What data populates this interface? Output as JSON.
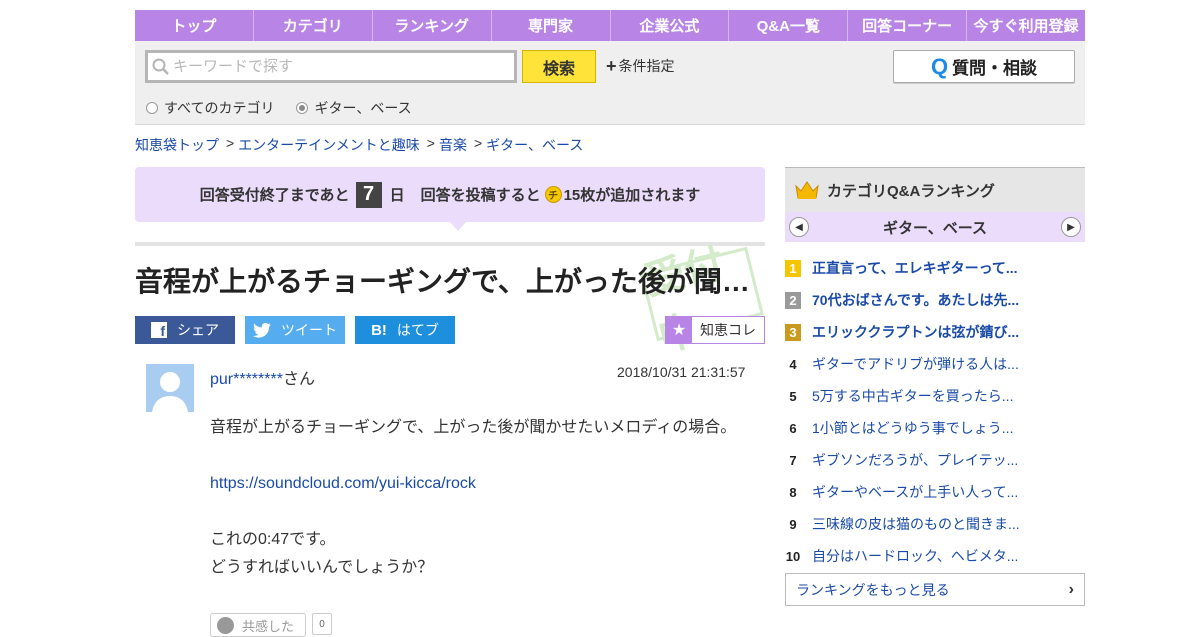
{
  "nav": [
    "トップ",
    "カテゴリ",
    "ランキング",
    "専門家",
    "企業公式",
    "Q&A一覧",
    "回答コーナー",
    "今すぐ利用登録"
  ],
  "search": {
    "placeholder": "キーワードで探す",
    "button": "検索",
    "conditions": "条件指定",
    "ask_button": "質問・相談",
    "scope_all": "すべてのカテゴリ",
    "scope_current": "ギター、ベース"
  },
  "breadcrumb": [
    "知恵袋トップ",
    "エンターテインメントと趣味",
    "音楽",
    "ギター、ベース"
  ],
  "deadline": {
    "prefix": "回答受付終了まであと",
    "days": "7",
    "day_unit": "日",
    "reward_prefix": "回答を投稿すると",
    "coin_glyph": "チ",
    "reward_suffix": "15枚が追加されます"
  },
  "question": {
    "title": "音程が上がるチョーギングで、上がった後が聞…",
    "stamp": "受付中",
    "share": {
      "facebook": "シェア",
      "twitter": "ツイート",
      "hatena": "はてブ"
    },
    "collection": "知恵コレ",
    "user": "pur********",
    "user_suffix": "さん",
    "date": "2018/10/31  21:31:57",
    "body": {
      "line1": "音程が上がるチョーギングで、上がった後が聞かせたいメロディの場合。",
      "link": "https://soundcloud.com/yui-kicca/rock",
      "line2": "これの0:47です。",
      "line3": "どうすればいいんでしょうか？"
    },
    "empathy_label": "共感した",
    "empathy_count": "0"
  },
  "ranking": {
    "title": "カテゴリQ&Aランキング",
    "category": "ギター、ベース",
    "items": [
      {
        "rank": "1",
        "title": "正直言って、エレキギターって..."
      },
      {
        "rank": "2",
        "title": "70代おばさんです。あたしは先..."
      },
      {
        "rank": "3",
        "title": "エリッククラプトンは弦が錆び..."
      },
      {
        "rank": "4",
        "title": "ギターでアドリブが弾ける人は..."
      },
      {
        "rank": "5",
        "title": "5万する中古ギターを買ったら..."
      },
      {
        "rank": "6",
        "title": "1小節とはどうゆう事でしょう..."
      },
      {
        "rank": "7",
        "title": "ギブソンだろうが、プレイテッ..."
      },
      {
        "rank": "8",
        "title": "ギターやベースが上手い人って..."
      },
      {
        "rank": "9",
        "title": "三味線の皮は猫のものと聞きま..."
      },
      {
        "rank": "10",
        "title": "自分はハードロック、ヘビメタ..."
      }
    ],
    "more": "ランキングをもっと見る"
  },
  "colors": {
    "nav_purple": "#b884e6",
    "search_yellow": "#ffe339",
    "link_blue": "#1a4aa8"
  }
}
